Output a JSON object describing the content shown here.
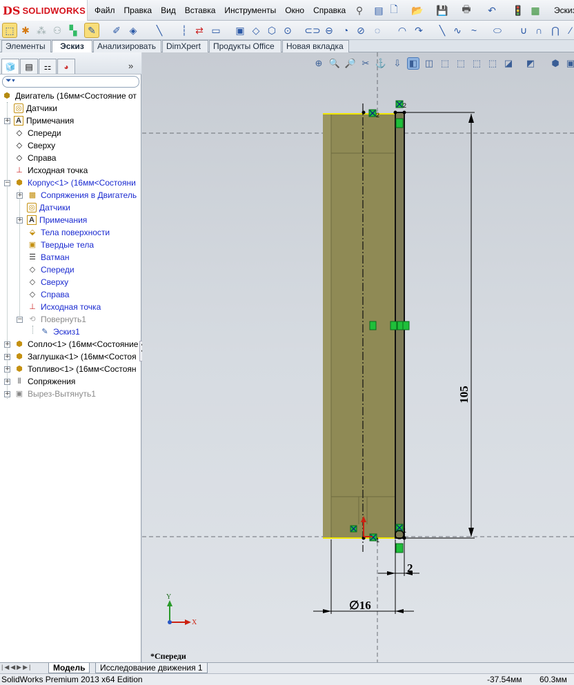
{
  "app": {
    "logo_mark": "DS",
    "logo_name": "SOLIDWORKS"
  },
  "menu": [
    "Файл",
    "Правка",
    "Вид",
    "Вставка",
    "Инструменты",
    "Окно",
    "Справка"
  ],
  "window_title_fragment": "Эскиз",
  "command_tabs": [
    "Элементы",
    "Эскиз",
    "Анализировать",
    "DimXpert",
    "Продукты Office",
    "Новая вкладка"
  ],
  "tree": {
    "root": "Двигатель  (16мм<Состояние от",
    "items": [
      {
        "label": "Датчики"
      },
      {
        "label": "Примечания"
      },
      {
        "label": "Спереди"
      },
      {
        "label": "Сверху"
      },
      {
        "label": "Справа"
      },
      {
        "label": "Исходная точка"
      },
      {
        "label": "Корпус<1> (16мм<Состояни"
      },
      {
        "label": "Сопряжения в Двигатель"
      },
      {
        "label": "Датчики"
      },
      {
        "label": "Примечания"
      },
      {
        "label": "Тела поверхности"
      },
      {
        "label": "Твердые тела"
      },
      {
        "label": "Ватман"
      },
      {
        "label": "Спереди"
      },
      {
        "label": "Сверху"
      },
      {
        "label": "Справа"
      },
      {
        "label": "Исходная точка"
      },
      {
        "label": "Повернуть1"
      },
      {
        "label": "Эскиз1"
      },
      {
        "label": "Сопло<1> (16мм<Состояние"
      },
      {
        "label": "Заглушка<1> (16мм<Состоя"
      },
      {
        "label": "Топливо<1> (16мм<Состоян"
      },
      {
        "label": "Сопряжения"
      },
      {
        "label": "Вырез-Вытянуть1"
      }
    ]
  },
  "sketch": {
    "dimensions": [
      {
        "name": "length",
        "value": "105"
      },
      {
        "name": "wall",
        "value": "2"
      },
      {
        "name": "diameter",
        "value": "∅16"
      }
    ],
    "point_labels": [
      "2",
      "2",
      "1",
      "1"
    ],
    "axis_x": "X",
    "axis_y": "Y",
    "view_name": "*Спереди"
  },
  "bottom_tabs": [
    "Модель",
    "Исследование движения 1"
  ],
  "status": {
    "edition": "SolidWorks Premium 2013 x64 Edition",
    "x_readout": "-37.54мм",
    "y_readout": "60.3мм"
  },
  "colors": {
    "accent": "#d5121b",
    "part_fill": "#8f8a55",
    "sketch_green": "#1fbf3a",
    "dim_black": "#000000"
  }
}
